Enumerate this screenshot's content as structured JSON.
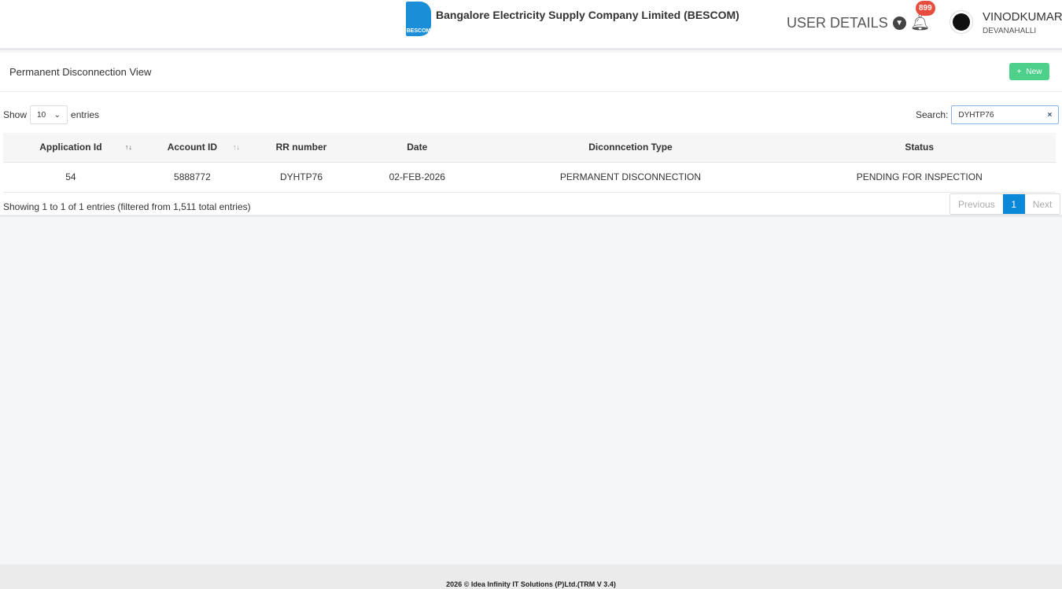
{
  "header": {
    "logo_text": "BESCOM",
    "brand": "Bangalore Electricity Supply Company Limited (BESCOM)",
    "user_details": "USER DETAILS",
    "notification_count": "899",
    "user_name": "VINODKUMAR",
    "user_location": "DEVANAHALLI"
  },
  "page": {
    "title": "Permanent Disconnection View",
    "new_label": "New"
  },
  "controls": {
    "show_label": "Show",
    "entries_value": "10",
    "entries_label": "entries",
    "search_label": "Search:",
    "search_value": "DYHTP76"
  },
  "table": {
    "headers": [
      "Application Id",
      "Account ID",
      "RR number",
      "Date",
      "Diconncetion Type",
      "Status"
    ],
    "rows": [
      [
        "54",
        "5888772",
        "DYHTP76",
        "02-FEB-2026",
        "PERMANENT DISCONNECTION",
        "PENDING FOR INSPECTION"
      ]
    ]
  },
  "info": "Showing 1 to 1 of 1 entries (filtered from 1,511 total entries)",
  "pagination": {
    "previous": "Previous",
    "current": "1",
    "next": "Next"
  },
  "footer": "2026 © Idea Infinity IT Solutions (P)Ltd.(TRM V 3.4)"
}
